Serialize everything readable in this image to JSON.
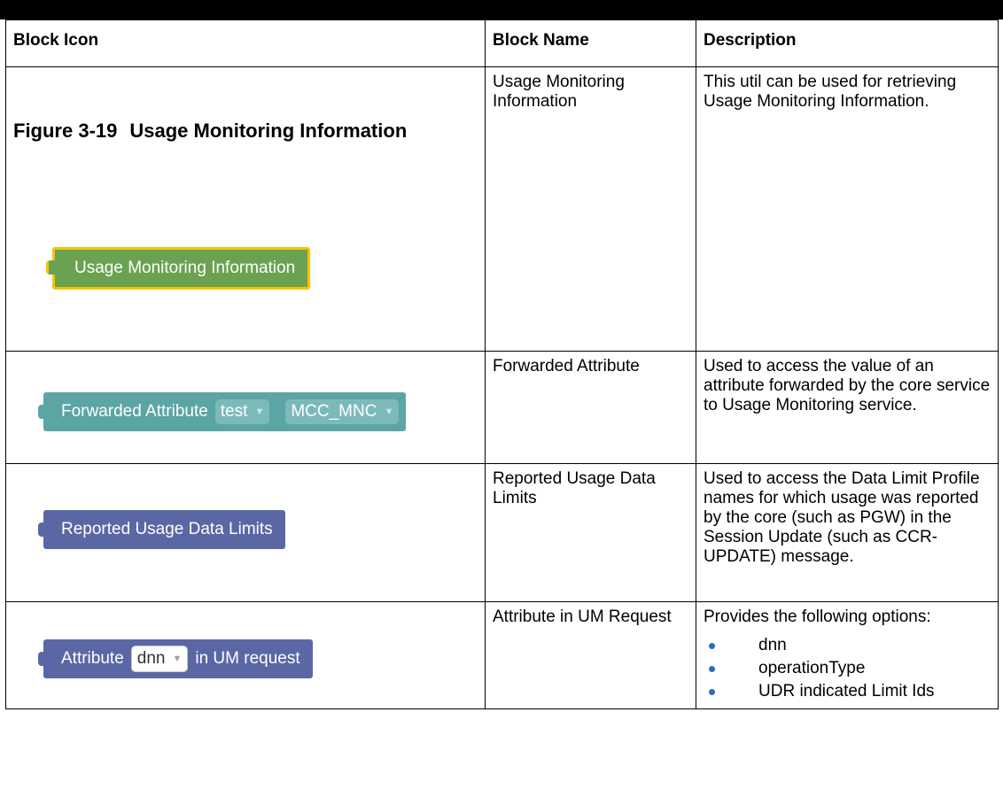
{
  "table": {
    "headers": [
      "Block Icon",
      "Block Name",
      "Description"
    ],
    "rows": [
      {
        "figure_number": "Figure 3-19",
        "figure_title": "Usage Monitoring Information",
        "block_label": "Usage Monitoring Information",
        "name": "Usage Monitoring Information",
        "description": "This util can be used for retrieving Usage Monitoring Information."
      },
      {
        "block_label": "Forwarded Attribute",
        "dropdown1": "test",
        "dropdown2": "MCC_MNC",
        "name": "Forwarded Attribute",
        "description": "Used to access the value of an attribute forwarded by the core service to Usage Monitoring service."
      },
      {
        "block_label": "Reported Usage Data Limits",
        "name": "Reported Usage Data Limits",
        "description": "Used to access the Data Limit Profile names for which usage was reported by the core (such as PGW) in the Session Update (such as CCR-UPDATE) message."
      },
      {
        "block_label_before": "Attribute",
        "dropdown": "dnn",
        "block_label_after": "in UM request",
        "name": "Attribute in UM Request",
        "description": "Provides the following options:",
        "options": [
          "dnn",
          "operationType",
          "UDR indicated Limit Ids"
        ]
      }
    ]
  },
  "colors": {
    "green_block": "#6aa251",
    "selected_outline": "#f8c200",
    "teal_block": "#5ba5a5",
    "purple_block": "#5b67a5",
    "bullet": "#2a6ebb"
  }
}
